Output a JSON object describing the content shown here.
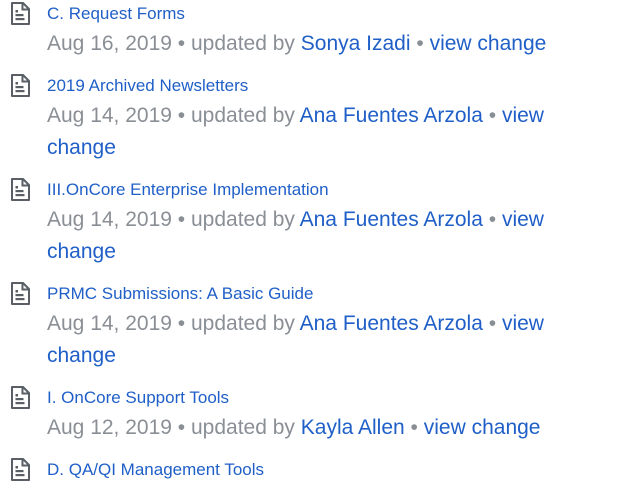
{
  "feed": {
    "items": [
      {
        "icon": "page-icon",
        "title": "C. Request Forms",
        "date": "Aug 16, 2019",
        "updated_by_text": "updated by",
        "author": "Sonya Izadi",
        "change_link": "view change"
      },
      {
        "icon": "page-icon",
        "title": "2019 Archived Newsletters",
        "date": "Aug 14, 2019",
        "updated_by_text": "updated by",
        "author": "Ana Fuentes Arzola",
        "change_link": "view change"
      },
      {
        "icon": "page-icon",
        "title": "III.OnCore Enterprise Implementation",
        "date": "Aug 14, 2019",
        "updated_by_text": "updated by",
        "author": "Ana Fuentes Arzola",
        "change_link": "view change"
      },
      {
        "icon": "page-icon",
        "title": "PRMC Submissions: A Basic Guide",
        "date": "Aug 14, 2019",
        "updated_by_text": "updated by",
        "author": "Ana Fuentes Arzola",
        "change_link": "view change"
      },
      {
        "icon": "page-icon",
        "title": "I. OnCore Support Tools",
        "date": "Aug 12, 2019",
        "updated_by_text": "updated by",
        "author": "Kayla Allen",
        "change_link": "view change"
      },
      {
        "icon": "page-icon",
        "title": "D. QA/QI Management Tools"
      }
    ]
  },
  "colors": {
    "link": "#1f5fc7",
    "meta": "#8a8f96",
    "icon_stroke": "#5a5f66"
  }
}
